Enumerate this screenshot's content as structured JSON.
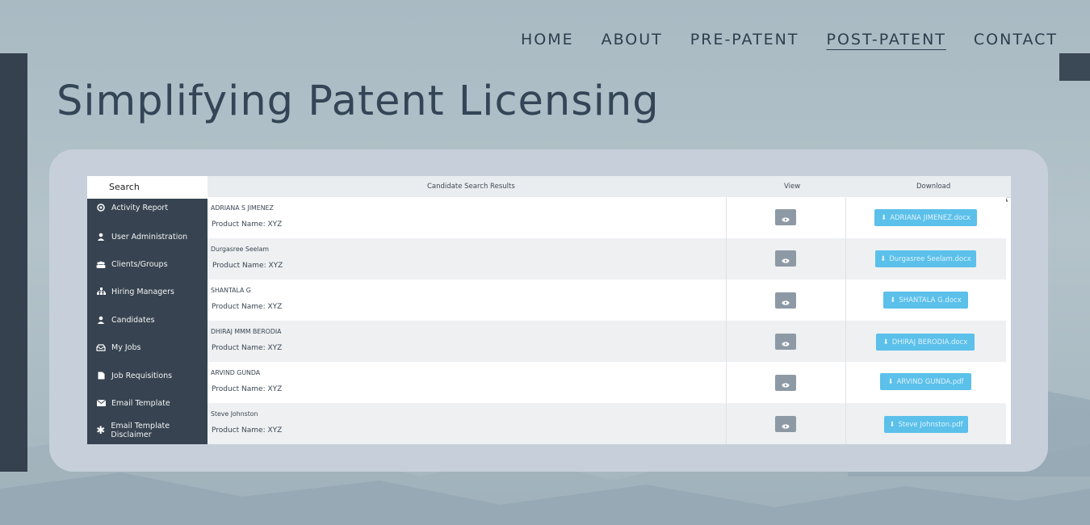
{
  "nav": {
    "items": [
      "HOME",
      "ABOUT",
      "PRE-PATENT",
      "POST-PATENT",
      "CONTACT"
    ],
    "active": "POST-PATENT"
  },
  "hero": {
    "title": "Simplifying Patent Licensing"
  },
  "sidebar": {
    "search": "Search",
    "items": [
      {
        "label": "Activity Report",
        "icon": "activity-icon"
      },
      {
        "label": "User Administration",
        "icon": "user-icon"
      },
      {
        "label": "Clients/Groups",
        "icon": "group-icon"
      },
      {
        "label": "Hiring Managers",
        "icon": "org-chart-icon"
      },
      {
        "label": "Candidates",
        "icon": "user-icon"
      },
      {
        "label": "My Jobs",
        "icon": "inbox-icon"
      },
      {
        "label": "Job Requisitions",
        "icon": "document-icon"
      },
      {
        "label": "Email Template",
        "icon": "envelope-icon"
      },
      {
        "label": "Email Template Disclaimer",
        "icon": "asterisk-icon"
      }
    ]
  },
  "table": {
    "headers": {
      "results": "Candidate Search Results",
      "view": "View",
      "download": "Download"
    },
    "rows": [
      {
        "name": "ADRIANA S JIMENEZ",
        "product": "Product Name: XYZ",
        "file": "ADRIANA JIMENEZ.docx"
      },
      {
        "name": "Durgasree Seelam",
        "product": "Product Name: XYZ",
        "file": "Durgasree Seelam.docx"
      },
      {
        "name": "SHANTALA G",
        "product": "Product Name: XYZ",
        "file": "SHANTALA G.docx"
      },
      {
        "name": "DHIRAJ MMM BERODIA",
        "product": "Product Name: XYZ",
        "file": "DHIRAJ BERODIA.docx"
      },
      {
        "name": "ARVIND GUNDA",
        "product": "Product Name: XYZ",
        "file": "ARVIND GUNDA.pdf"
      },
      {
        "name": "Steve Johnston",
        "product": "Product Name: XYZ",
        "file": "Steve Johnston.pdf"
      }
    ]
  },
  "colors": {
    "accent": "#5bc0ea",
    "sidebar": "#374350",
    "heading": "#334556"
  }
}
